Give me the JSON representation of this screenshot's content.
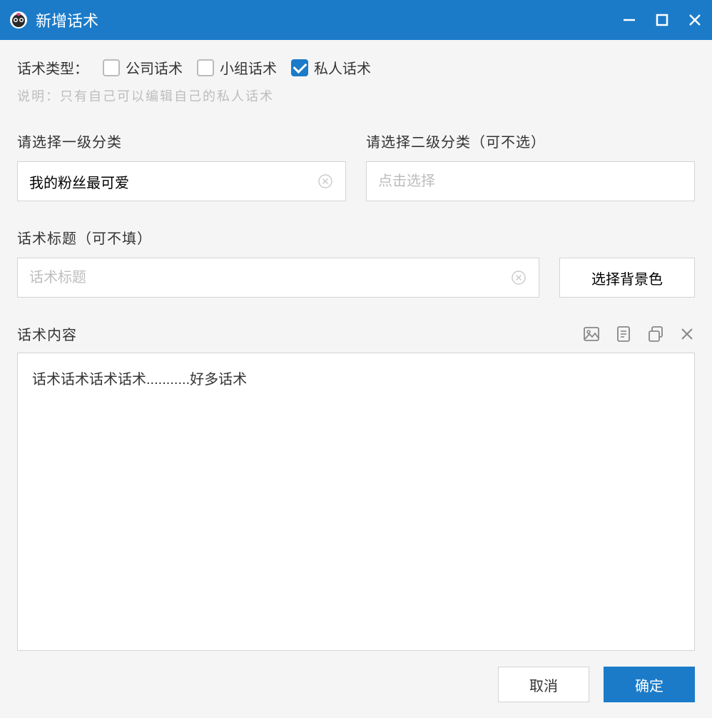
{
  "window": {
    "title": "新增话术"
  },
  "typeSection": {
    "label": "话术类型：",
    "options": {
      "company": {
        "label": "公司话术",
        "checked": false
      },
      "group": {
        "label": "小组话术",
        "checked": false
      },
      "private": {
        "label": "私人话术",
        "checked": true
      }
    },
    "hint": "说明：只有自己可以编辑自己的私人话术"
  },
  "primaryCategory": {
    "label": "请选择一级分类",
    "value": "我的粉丝最可爱"
  },
  "secondaryCategory": {
    "label": "请选择二级分类（可不选）",
    "placeholder": "点击选择",
    "value": ""
  },
  "titleField": {
    "label": "话术标题（可不填）",
    "placeholder": "话术标题",
    "value": "",
    "bgColorBtn": "选择背景色"
  },
  "contentField": {
    "label": "话术内容",
    "value": "话术话术话术话术...........好多话术"
  },
  "footer": {
    "cancel": "取消",
    "ok": "确定"
  }
}
